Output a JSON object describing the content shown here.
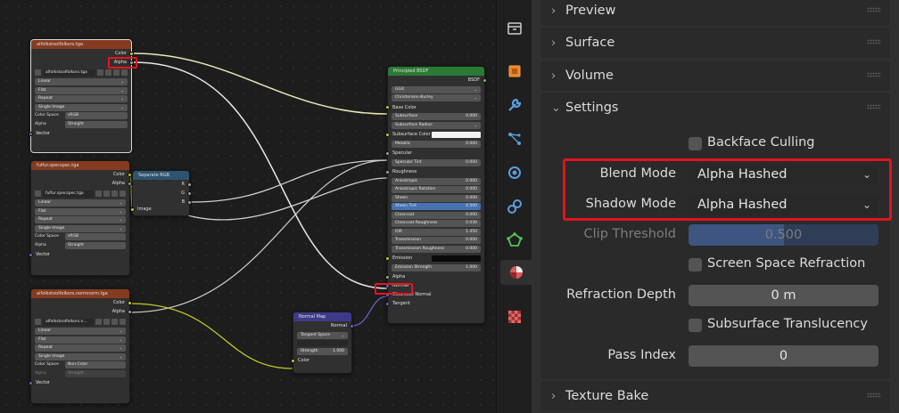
{
  "nodes": {
    "tex1": {
      "title": "alfolkstoolfolkors.tga",
      "outputs": [
        "Color",
        "Alpha"
      ],
      "image_name": "alfolkstoolfolkors.tga",
      "fields": [
        "Linear",
        "Flat",
        "Repeat",
        "Single Image"
      ],
      "color_space": {
        "label": "Color Space",
        "value": "sRGB"
      },
      "alpha": {
        "label": "Alpha",
        "value": "Straight"
      },
      "input": "Vector"
    },
    "tex2": {
      "title": "fulfur.specspec.tga",
      "outputs": [
        "Color",
        "Alpha"
      ],
      "image_name": "fulfur.specspec.tga",
      "fields": [
        "Linear",
        "Flat",
        "Repeat",
        "Single Image"
      ],
      "color_space": {
        "label": "Color Space",
        "value": "sRGB"
      },
      "alpha": {
        "label": "Alpha",
        "value": "Straight"
      },
      "input": "Vector"
    },
    "tex3": {
      "title": "alfolkstoolfolkors.normnorm.tga",
      "outputs": [
        "Color",
        "Alpha"
      ],
      "image_name": "alfolkstoolfolkors.n...",
      "fields": [
        "Linear",
        "Flat",
        "Repeat",
        "Single Image"
      ],
      "color_space": {
        "label": "Color Space",
        "value": "Non-Color"
      },
      "alpha": {
        "label": "Alpha",
        "value": "Straight"
      },
      "input": "Vector"
    },
    "sep": {
      "title": "Separate RGB",
      "outputs": [
        "R",
        "G",
        "B"
      ],
      "input": "Image"
    },
    "normal": {
      "title": "Normal Map",
      "output": "Normal",
      "space": "Tangent Space",
      "uv": "",
      "strength_label": "Strength",
      "strength_value": "1.000",
      "input": "Color"
    },
    "bsdf": {
      "title": "Principled BSDF",
      "output": "BSDF",
      "distribution": "GGX",
      "subsurface_method": "Christensen-Burley",
      "inputs": [
        {
          "label": "Base Color",
          "type": "socket"
        },
        {
          "label": "Subsurface",
          "value": "0.000"
        },
        {
          "label": "Subsurface Radius",
          "type": "dropdown"
        },
        {
          "label": "Subsurface Color",
          "type": "color"
        },
        {
          "label": "Metallic",
          "value": "0.000"
        },
        {
          "label": "Specular",
          "type": "socket"
        },
        {
          "label": "Specular Tint",
          "value": "0.000"
        },
        {
          "label": "Roughness",
          "type": "socket"
        },
        {
          "label": "Anisotropic",
          "value": "0.000"
        },
        {
          "label": "Anisotropic Rotation",
          "value": "0.000"
        },
        {
          "label": "Sheen",
          "value": "0.000"
        },
        {
          "label": "Sheen Tint",
          "value": "0.500",
          "blue": true
        },
        {
          "label": "Clearcoat",
          "value": "0.000"
        },
        {
          "label": "Clearcoat Roughness",
          "value": "0.030"
        },
        {
          "label": "IOR",
          "value": "1.450"
        },
        {
          "label": "Transmission",
          "value": "0.000"
        },
        {
          "label": "Transmission Roughness",
          "value": "0.000"
        },
        {
          "label": "Emission",
          "type": "black"
        },
        {
          "label": "Emission Strength",
          "value": "1.000"
        },
        {
          "label": "Alpha",
          "type": "socket"
        },
        {
          "label": "Normal",
          "type": "socket"
        },
        {
          "label": "Clearcoat Normal",
          "type": "socket"
        },
        {
          "label": "Tangent",
          "type": "socket"
        }
      ]
    }
  },
  "properties": {
    "panels": {
      "preview": "Preview",
      "surface": "Surface",
      "volume": "Volume",
      "settings": "Settings",
      "texture_bake": "Texture Bake"
    },
    "backface_culling": {
      "label": "Backface Culling",
      "checked": false
    },
    "blend_mode": {
      "label": "Blend Mode",
      "value": "Alpha Hashed"
    },
    "shadow_mode": {
      "label": "Shadow Mode",
      "value": "Alpha Hashed"
    },
    "clip_threshold": {
      "label": "Clip Threshold",
      "value": "0.500",
      "fill": 0.5
    },
    "screen_space_refraction": {
      "label": "Screen Space Refraction",
      "checked": false
    },
    "refraction_depth": {
      "label": "Refraction Depth",
      "value": "0 m"
    },
    "subsurface_translucency": {
      "label": "Subsurface Translucency",
      "checked": false
    },
    "pass_index": {
      "label": "Pass Index",
      "value": "0"
    }
  },
  "tabs": [
    "world-icon",
    "object-icon",
    "modifier-icon",
    "particles-icon",
    "physics-icon",
    "constraints-icon",
    "object-data-icon",
    "material-icon",
    "texture-icon"
  ],
  "colors": {
    "texture_header": "#843b1f",
    "shader_header": "#2a7a33",
    "vector_header": "#3e3a8a",
    "converter_header": "#2d5470",
    "highlight": "#e0141c",
    "socket_color": "#c7c729",
    "socket_float": "#a1a1a1",
    "socket_vector": "#6363c7",
    "socket_shader": "#63c763"
  }
}
